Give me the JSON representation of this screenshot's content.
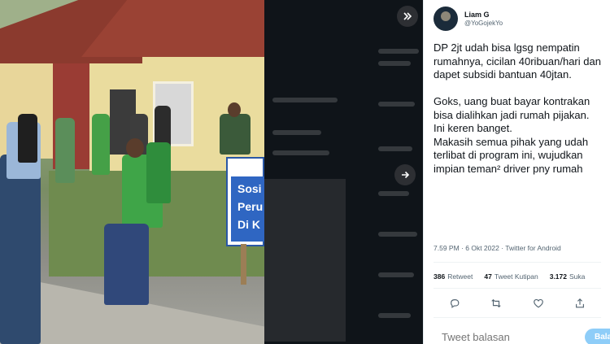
{
  "media": {
    "sign_text": [
      "Sosi",
      "Peru",
      "Di K"
    ]
  },
  "tweet": {
    "author_name": "Liam G",
    "author_handle": "@YoGojekYo",
    "text": "DP 2jt udah bisa lgsg nempatin rumahnya, cicilan 40ribuan/hari dan dapet subsidi bantuan 40jtan.\n\nGoks, uang buat bayar kontrakan bisa dialihkan jadi rumah pijakan.\nIni keren banget.\nMakasih semua pihak yang udah terlibat di program ini, wujudkan impian teman² driver pny rumah",
    "time": "7.59 PM",
    "date": "6 Okt 2022",
    "source": "Twitter for Android",
    "separator": "·"
  },
  "stats": {
    "retweets": "386",
    "retweets_label": "Retweet",
    "quotes": "47",
    "quotes_label": "Tweet Kutipan",
    "likes": "3.172",
    "likes_label": "Suka"
  },
  "reply": {
    "placeholder": "Tweet balasan",
    "button_label": "Balas"
  },
  "nav": {
    "collapse_icon": "double-chevron-right-icon",
    "next_icon": "arrow-right-icon"
  },
  "colors": {
    "accent": "#1d9bf0",
    "accent_disabled": "#8ecdf8",
    "text_secondary": "#536471"
  }
}
